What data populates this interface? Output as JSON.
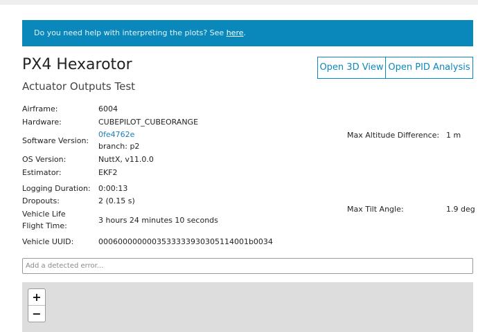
{
  "banner": {
    "text": "Do you need help with interpreting the plots? See ",
    "link": "here",
    "suffix": "."
  },
  "header": {
    "title": "PX4 Hexarotor",
    "subtitle": "Actuator Outputs Test",
    "open_3d_label": "Open 3D View",
    "open_pid_label": "Open PID Analysis"
  },
  "info": {
    "airframe_label": "Airframe:",
    "airframe": "6004",
    "hardware_label": "Hardware:",
    "hardware": "CUBEPILOT_CUBEORANGE",
    "software_label": "Software Version:",
    "software_hash": "0fe4762e",
    "software_branch": "branch: p2",
    "os_label": "OS Version:",
    "os": "NuttX, v11.0.0",
    "estimator_label": "Estimator:",
    "estimator": "EKF2",
    "logging_label": "Logging Duration:",
    "logging": "0:00:13",
    "dropouts_label": "Dropouts:",
    "dropouts": "2 (0.15 s)",
    "life_label_1": "Vehicle Life",
    "life_label_2": "Flight Time:",
    "life": "3 hours 24 minutes 10 seconds",
    "uuid_label": "Vehicle UUID:",
    "uuid": "0006000000003533333930305114001b0034"
  },
  "stats": {
    "alt_label": "Max Altitude Difference:",
    "alt": "1 m",
    "tilt_label": "Max Tilt Angle:",
    "tilt": "1.9 deg"
  },
  "error_input": {
    "placeholder": "Add a detected error..."
  },
  "map": {
    "zoom_in": "+",
    "zoom_out": "−"
  }
}
